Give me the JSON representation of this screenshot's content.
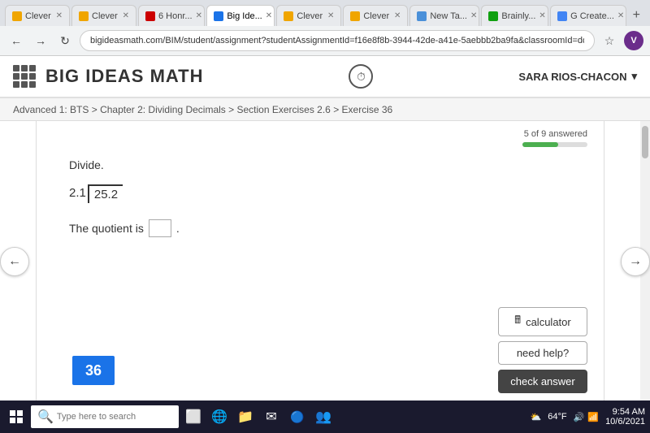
{
  "browser": {
    "tabs": [
      {
        "label": "Clever",
        "active": false,
        "favicon_color": "#f0a500"
      },
      {
        "label": "Clever",
        "active": false,
        "favicon_color": "#f0a500"
      },
      {
        "label": "6 Honr...",
        "active": false,
        "favicon_color": "#c00"
      },
      {
        "label": "Big Ide...",
        "active": true,
        "favicon_color": "#1a73e8"
      },
      {
        "label": "Clever",
        "active": false,
        "favicon_color": "#f0a500"
      },
      {
        "label": "Clever",
        "active": false,
        "favicon_color": "#f0a500"
      },
      {
        "label": "New Ta...",
        "active": false,
        "favicon_color": "#4a90d9"
      },
      {
        "label": "Brainly...",
        "active": false,
        "favicon_color": "#10a010"
      },
      {
        "label": "G Create...",
        "active": false,
        "favicon_color": "#4285F4"
      }
    ],
    "url": "bigideasmath.com/BIM/student/assignment?studentAssignmentId=f16e8f8b-3944-42de-a41e-5aebbb2ba9fa&classroomId=dd1c6879-7a53-4c08-879...",
    "user_profile_initial": "V"
  },
  "app": {
    "title": "BIG IDEAS MATH",
    "user_name": "SARA RIOS-CHACON"
  },
  "breadcrumb": {
    "text": "Advanced 1: BTS > Chapter 2: Dividing Decimals > Section Exercises 2.6 > Exercise 36"
  },
  "progress": {
    "text": "5 of 9 answered",
    "filled_fraction": 0.55
  },
  "question": {
    "instruction": "Divide.",
    "problem_label": "2.1",
    "dividend": "25.2",
    "quotient_prefix": "The quotient is",
    "answer_placeholder": ""
  },
  "exercise_number": "36",
  "buttons": {
    "calculator": "calculator",
    "need_help": "need help?",
    "check_answer": "check answer"
  },
  "taskbar": {
    "search_placeholder": "Type here to search",
    "time": "9:54 AM",
    "date": "10/6/2021",
    "temperature": "64°F"
  }
}
